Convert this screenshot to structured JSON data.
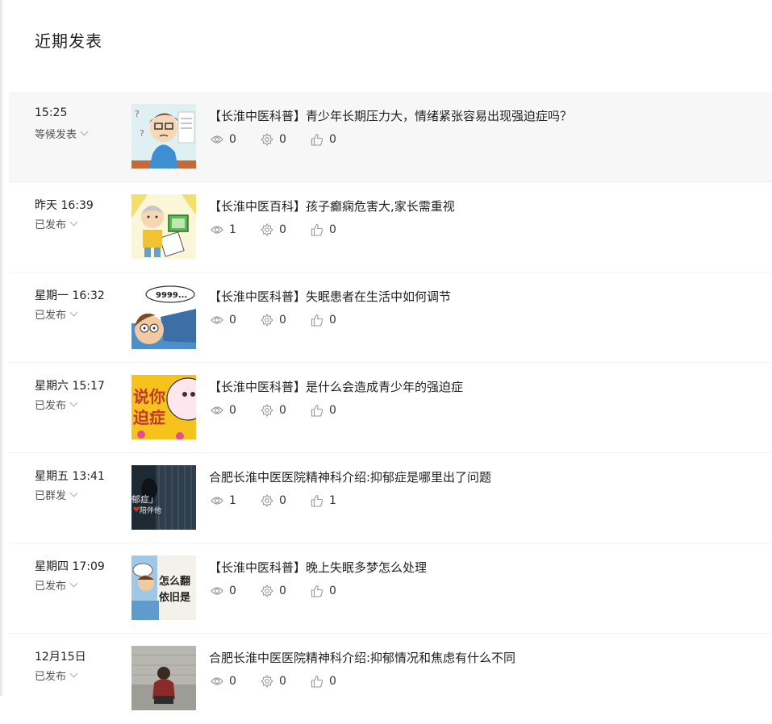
{
  "section": {
    "title": "近期发表"
  },
  "posts": [
    {
      "time": "15:25",
      "status": "等候发表",
      "title": "【长淮中医科普】青少年长期压力大，情绪紧张容易出现强迫症吗？",
      "views": "0",
      "shares": "0",
      "likes": "0"
    },
    {
      "time": "昨天 16:39",
      "status": "已发布",
      "title": "【长淮中医百科】孩子癫痫危害大,家长需重视",
      "views": "1",
      "shares": "0",
      "likes": "0"
    },
    {
      "time": "星期一 16:32",
      "status": "已发布",
      "title": "【长淮中医科普】失眠患者在生活中如何调节",
      "views": "0",
      "shares": "0",
      "likes": "0",
      "thumb_text": "9999..."
    },
    {
      "time": "星期六 15:17",
      "status": "已发布",
      "title": "【长淮中医科普】是什么会造成青少年的强迫症",
      "views": "0",
      "shares": "0",
      "likes": "0",
      "thumb_text_1": "说你",
      "thumb_text_2": "迫症"
    },
    {
      "time": "星期五 13:41",
      "status": "已群发",
      "title": "合肥长淮中医医院精神科介绍:抑郁症是哪里出了问题",
      "views": "1",
      "shares": "0",
      "likes": "1",
      "thumb_text_1": "郁症」",
      "thumb_text_2": "陪伴他"
    },
    {
      "time": "星期四 17:09",
      "status": "已发布",
      "title": "【长淮中医科普】晚上失眠多梦怎么处理",
      "views": "0",
      "shares": "0",
      "likes": "0",
      "thumb_text_1": "怎么翻",
      "thumb_text_2": "依旧是"
    },
    {
      "time": "12月15日",
      "status": "已发布",
      "title": "合肥长淮中医医院精神科介绍:抑郁情况和焦虑有什么不同",
      "views": "0",
      "shares": "0",
      "likes": "0"
    }
  ],
  "icons": {
    "views": "eye-icon",
    "shares": "share-icon",
    "likes": "thumbs-up-icon",
    "status": "chevron-down-icon"
  },
  "colors": {
    "active_row_bg": "#f7f7f7",
    "icon_gray": "#999999"
  }
}
